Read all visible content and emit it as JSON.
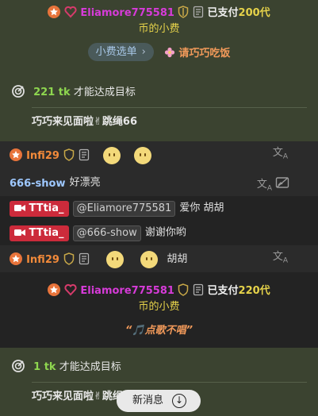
{
  "tip1": {
    "username": "Eliamore775581",
    "text_prefix": "已支付",
    "amount": "200代",
    "text_suffix": "币的小费",
    "menu_label": "小费选单",
    "treat_label": "请巧巧吃饭"
  },
  "goal1": {
    "amount": "221 tk",
    "suffix": "才能达成目标",
    "text": "巧巧来见面啦✌跳绳66"
  },
  "chat": {
    "row1_user": "Infi29",
    "row2_user": "666-show",
    "row2_msg": "好漂亮",
    "row3_user": "TTtia_",
    "row3_mention": "@Eliamore775581",
    "row3_msg": "爱你 胡胡",
    "row4_user": "TTtia_",
    "row4_mention": "@666-show",
    "row4_msg": "谢谢你哟",
    "row5_user": "Infi29",
    "row5_msg": "胡胡"
  },
  "tip2": {
    "username": "Eliamore775581",
    "text_prefix": "已支付",
    "amount": "220代",
    "text_suffix": "币的小费",
    "song": "“🎵点歌不唱”"
  },
  "goal2": {
    "amount": "1 tk",
    "suffix": "才能达成目标",
    "text": "巧巧来见面啦✌跳绳"
  },
  "new_messages_label": "新消息",
  "colors": {
    "olive_bg": "#3b4330",
    "accent_green": "#8ed64f",
    "username_orange": "#f28a3a",
    "chip_red": "#cc2b3b"
  }
}
